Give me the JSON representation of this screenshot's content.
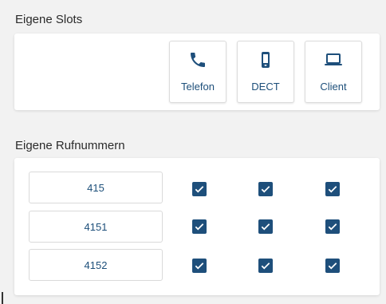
{
  "slots": {
    "title": "Eigene Slots",
    "buttons": [
      {
        "label": "Telefon",
        "icon": "phone-icon"
      },
      {
        "label": "DECT",
        "icon": "mobile-phone-icon"
      },
      {
        "label": "Client",
        "icon": "laptop-icon"
      }
    ]
  },
  "numbers": {
    "title": "Eigene Rufnummern",
    "rows": [
      {
        "number": "415",
        "telefon": true,
        "dect": true,
        "client": true
      },
      {
        "number": "4151",
        "telefon": true,
        "dect": true,
        "client": true
      },
      {
        "number": "4152",
        "telefon": true,
        "dect": true,
        "client": true
      }
    ]
  },
  "colors": {
    "accent": "#1e4f7b",
    "label_text": "#1d4f7a",
    "card_bg": "#ffffff",
    "page_bg": "#f2f2f2"
  }
}
